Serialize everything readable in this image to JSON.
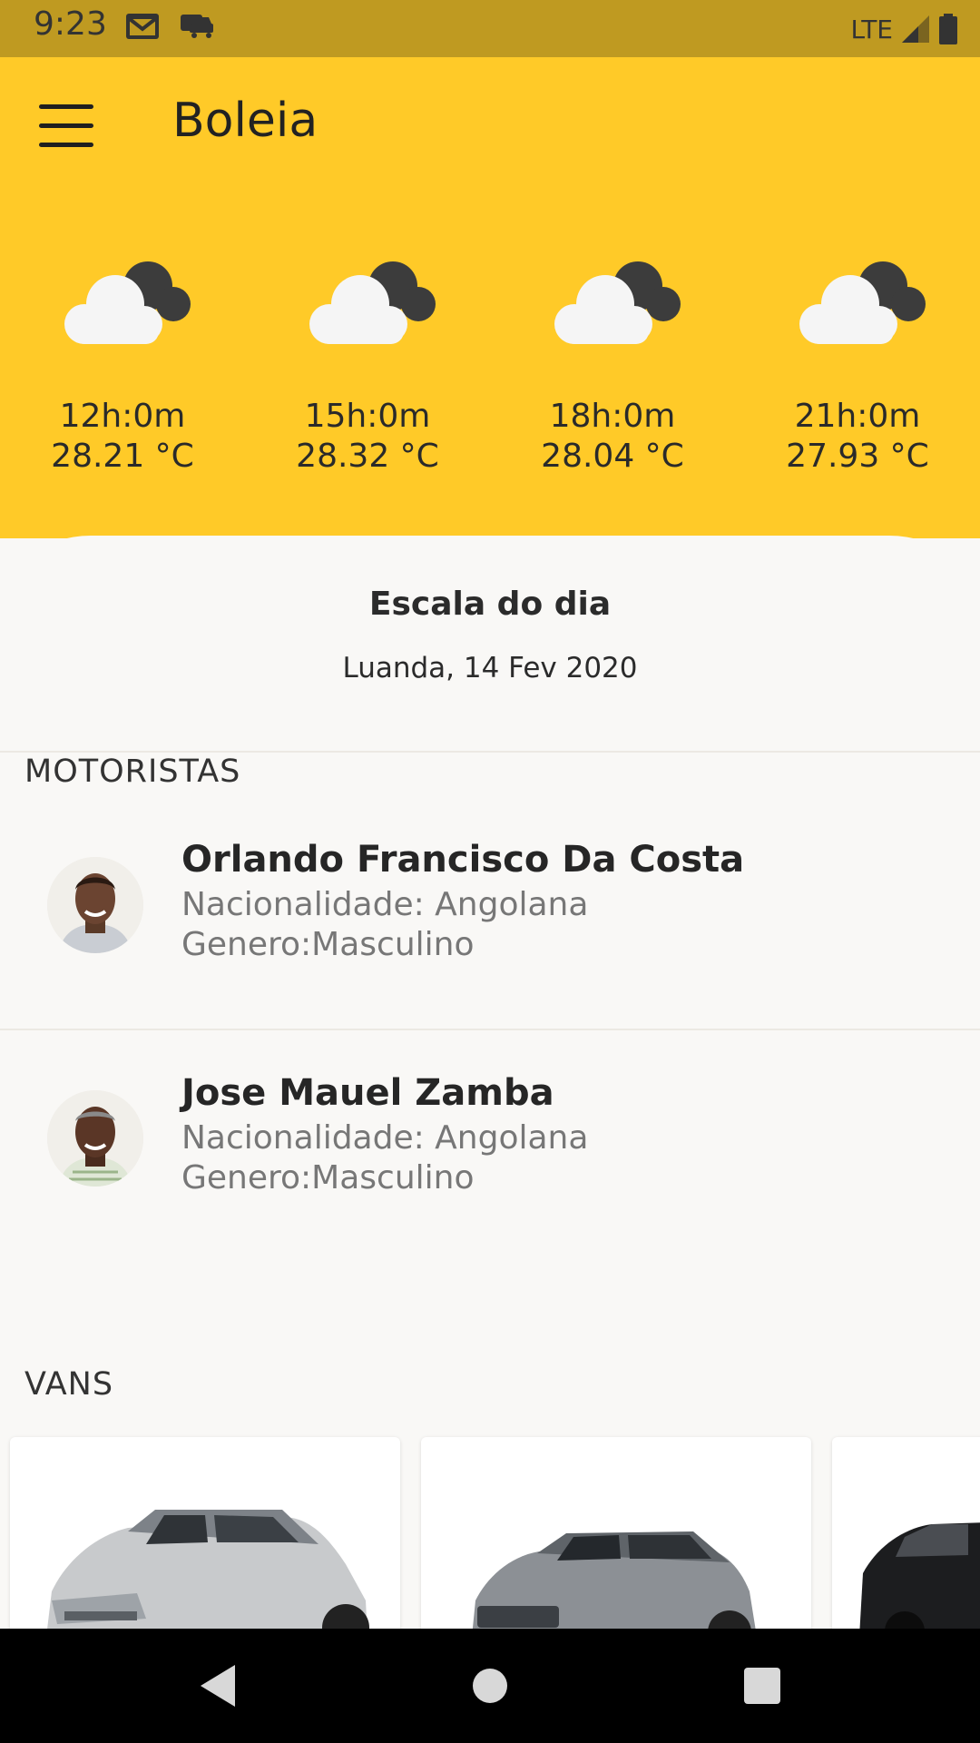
{
  "status_bar": {
    "time": "9:23",
    "network": "LTE",
    "icons": [
      "gmail-icon",
      "car-notification-icon",
      "signal-icon",
      "battery-icon"
    ]
  },
  "header": {
    "app_title": "Boleia",
    "menu_icon": "hamburger-menu-icon",
    "background_color": "#ffca28"
  },
  "weather": [
    {
      "time": "12h:0m",
      "temp": "28.21 °C",
      "icon": "cloudy-icon"
    },
    {
      "time": "15h:0m",
      "temp": "28.32 °C",
      "icon": "cloudy-icon"
    },
    {
      "time": "18h:0m",
      "temp": "28.04 °C",
      "icon": "cloudy-icon"
    },
    {
      "time": "21h:0m",
      "temp": "27.93 °C",
      "icon": "cloudy-icon"
    }
  ],
  "schedule": {
    "title": "Escala do dia",
    "subtitle": "Luanda, 14 Fev 2020"
  },
  "drivers_section": {
    "label": "MOTORISTAS",
    "drivers": [
      {
        "name": "Orlando Francisco Da Costa",
        "nationality": "Nacionalidade: Angolana",
        "gender": "Genero:Masculino"
      },
      {
        "name": "Jose Mauel Zamba",
        "nationality": "Nacionalidade: Angolana",
        "gender": "Genero:Masculino"
      }
    ]
  },
  "vans_section": {
    "label": "VANS",
    "vans": [
      {
        "image": "silver-suv-image"
      },
      {
        "image": "gray-suv-image"
      },
      {
        "image": "black-hatchback-image"
      }
    ]
  },
  "nav_bar": {
    "buttons": [
      "back-icon",
      "home-icon",
      "recents-icon"
    ]
  }
}
